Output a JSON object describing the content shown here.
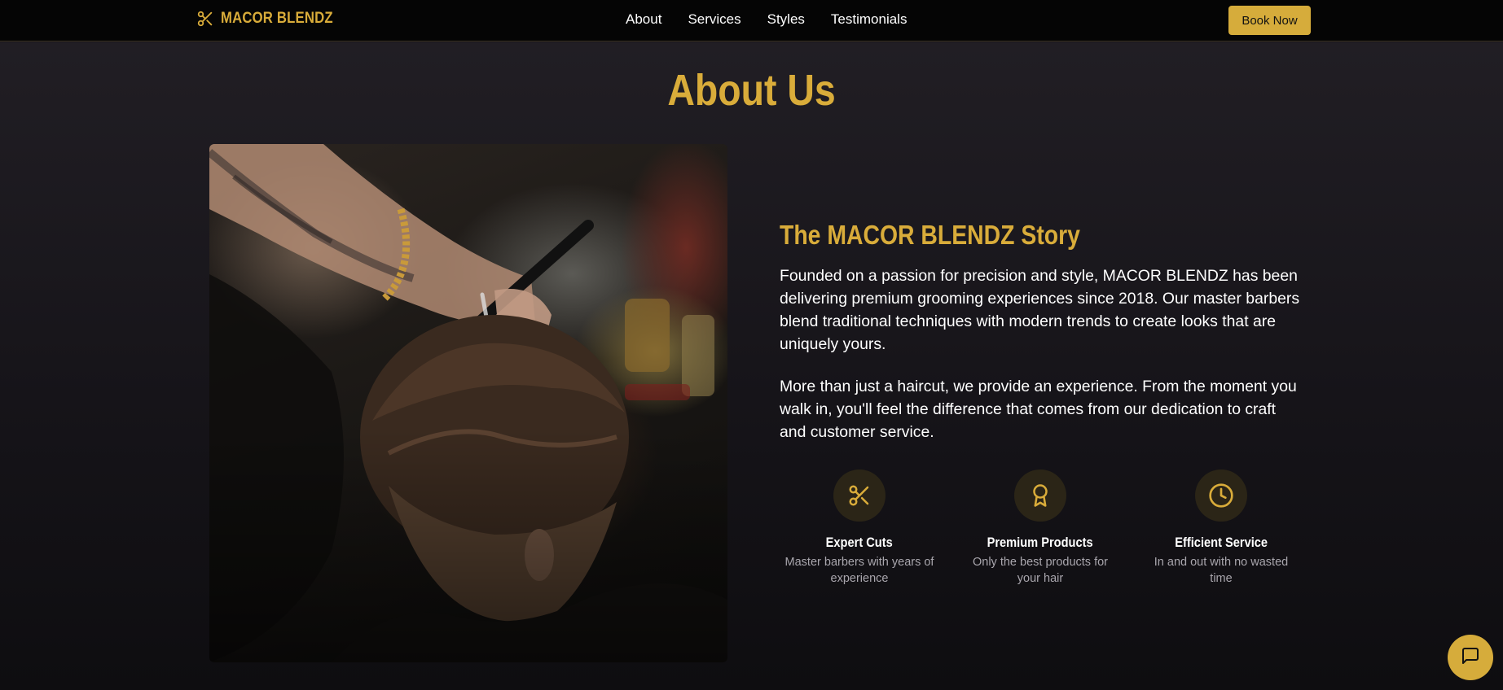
{
  "brand": {
    "name": "MACOR BLENDZ",
    "icon": "scissors-icon"
  },
  "nav": {
    "links": [
      {
        "label": "About"
      },
      {
        "label": "Services"
      },
      {
        "label": "Styles"
      },
      {
        "label": "Testimonials"
      }
    ],
    "cta_label": "Book Now"
  },
  "about": {
    "title": "About Us",
    "story_title": "The MACOR BLENDZ Story",
    "paragraphs": [
      "Founded on a passion for precision and style, MACOR BLENDZ has been delivering premium grooming experiences since 2018. Our master barbers blend traditional techniques with modern trends to create looks that are uniquely yours.",
      "More than just a haircut, we provide an experience. From the moment you walk in, you'll feel the difference that comes from our dedication to craft and customer service."
    ],
    "features": [
      {
        "icon": "scissors-icon",
        "title": "Expert Cuts",
        "desc": "Master barbers with years of experience"
      },
      {
        "icon": "award-icon",
        "title": "Premium Products",
        "desc": "Only the best products for your hair"
      },
      {
        "icon": "clock-icon",
        "title": "Efficient Service",
        "desc": "In and out with no wasted time"
      }
    ]
  },
  "chat": {
    "icon": "chat-bubble-icon"
  },
  "colors": {
    "accent": "#d6ac3b",
    "background": "#17151a",
    "nav": "#050505"
  }
}
